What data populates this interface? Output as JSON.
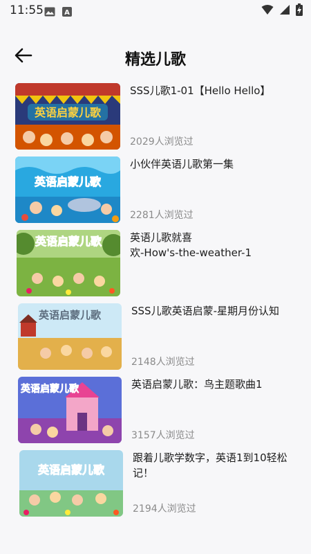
{
  "status": {
    "time": "11:55"
  },
  "header": {
    "title": "精选儿歌"
  },
  "thumb_text": "英语启蒙儿歌",
  "items": [
    {
      "title": "SSS儿歌1-01【Hello Hello】",
      "views": "2029人浏览过"
    },
    {
      "title": "小伙伴英语儿歌第一集",
      "views": "2281人浏览过"
    },
    {
      "title": "英语儿歌就喜欢-How's-the-weather-1",
      "views": ""
    },
    {
      "title": "SSS儿歌英语启蒙-星期月份认知",
      "views": "2148人浏览过"
    },
    {
      "title": "英语启蒙儿歌：鸟主题歌曲1",
      "views": "3157人浏览过"
    },
    {
      "title": "跟着儿歌学数字，英语1到10轻松记！",
      "views": "2194人浏览过"
    }
  ]
}
